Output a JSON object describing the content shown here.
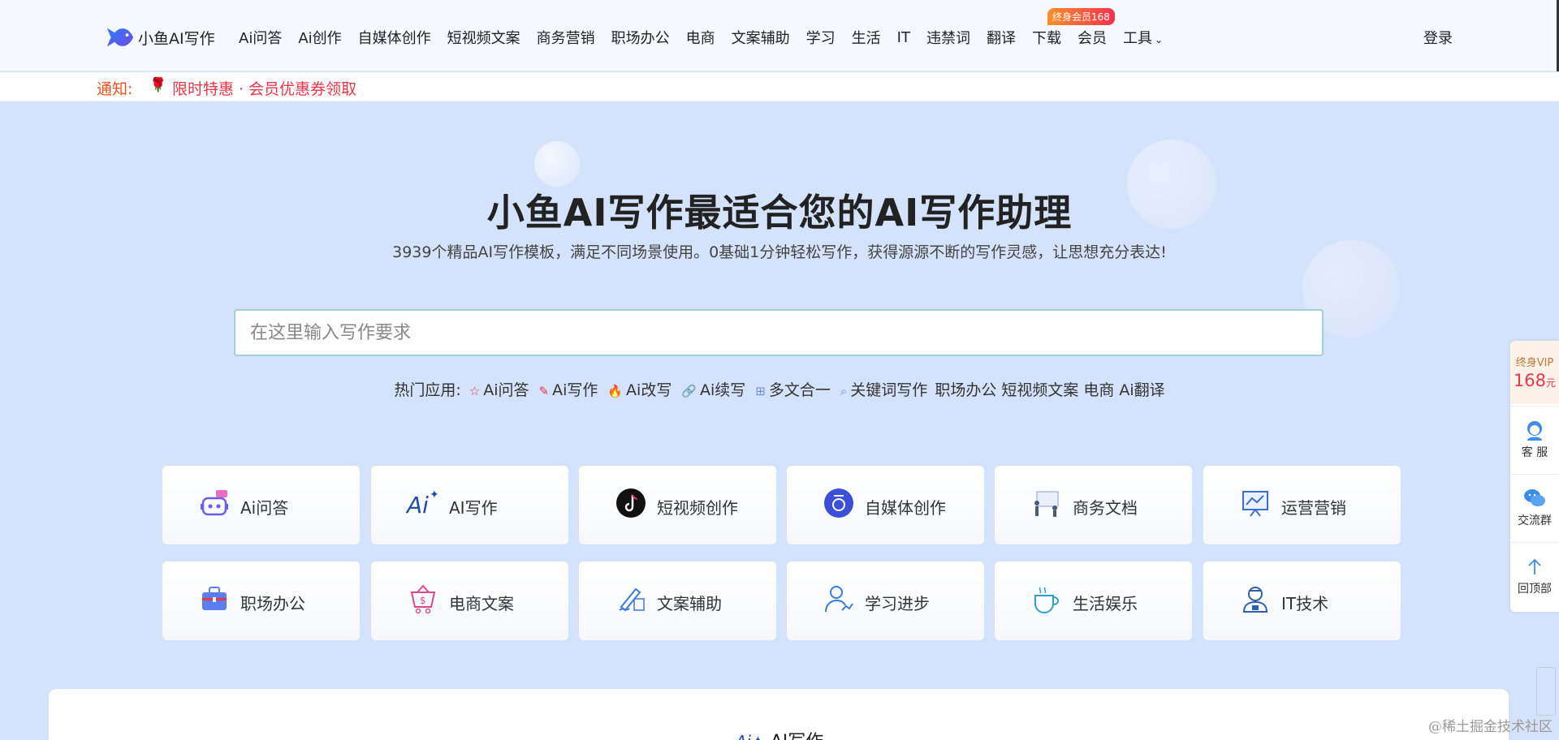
{
  "header": {
    "logo_text": "小鱼AI写作",
    "nav": [
      {
        "label": "Ai问答"
      },
      {
        "label": "Ai创作"
      },
      {
        "label": "自媒体创作"
      },
      {
        "label": "短视频文案"
      },
      {
        "label": "商务营销"
      },
      {
        "label": "职场办公"
      },
      {
        "label": "电商"
      },
      {
        "label": "文案辅助"
      },
      {
        "label": "学习"
      },
      {
        "label": "生活"
      },
      {
        "label": "IT"
      },
      {
        "label": "违禁词"
      },
      {
        "label": "翻译"
      },
      {
        "label": "下载"
      },
      {
        "label": "会员"
      },
      {
        "label": "工具"
      }
    ],
    "vip_badge": "终身会员168",
    "login": "登录"
  },
  "notice": {
    "label": "通知:",
    "text": "限时特惠 · 会员优惠券领取"
  },
  "hero": {
    "title": "小鱼AI写作最适合您的AI写作助理",
    "subtitle": "3939个精品AI写作模板，满足不同场景使用。0基础1分钟轻松写作，获得源源不断的写作灵感，让思想充分表达!",
    "search_placeholder": "在这里输入写作要求"
  },
  "hot_apps": {
    "label": "热门应用:",
    "items": [
      {
        "label": "Ai问答"
      },
      {
        "label": "Ai写作"
      },
      {
        "label": "Ai改写"
      },
      {
        "label": "Ai续写"
      },
      {
        "label": "多文合一"
      },
      {
        "label": "关键词写作"
      },
      {
        "label": "职场办公"
      },
      {
        "label": "短视频文案"
      },
      {
        "label": "电商"
      },
      {
        "label": "Ai翻译"
      }
    ]
  },
  "categories": [
    {
      "label": "Ai问答",
      "icon": "robot-icon"
    },
    {
      "label": "AI写作",
      "icon": "ai-sparkle-icon"
    },
    {
      "label": "短视频创作",
      "icon": "tiktok-icon"
    },
    {
      "label": "自媒体创作",
      "icon": "media-icon"
    },
    {
      "label": "商务文档",
      "icon": "presentation-icon"
    },
    {
      "label": "运营营销",
      "icon": "chart-board-icon"
    },
    {
      "label": "职场办公",
      "icon": "briefcase-icon"
    },
    {
      "label": "电商文案",
      "icon": "shopping-basket-icon"
    },
    {
      "label": "文案辅助",
      "icon": "pen-write-icon"
    },
    {
      "label": "学习进步",
      "icon": "user-growth-icon"
    },
    {
      "label": "生活娱乐",
      "icon": "coffee-cup-icon"
    },
    {
      "label": "IT技术",
      "icon": "engineer-icon"
    }
  ],
  "bottom": {
    "title": "AI写作"
  },
  "sidebar": {
    "vip_line1": "终身VIP",
    "vip_price": "168",
    "vip_unit": "元",
    "items": [
      {
        "label": "客 服",
        "icon": "customer-service-icon"
      },
      {
        "label": "交流群",
        "icon": "wechat-icon"
      },
      {
        "label": "回顶部",
        "icon": "arrow-up-icon"
      }
    ]
  },
  "watermark": "@稀土掘金技术社区",
  "colors": {
    "page_bg": "#d5e2fb",
    "notice_red": "#e8364b",
    "accent_teal": "#9fd3d8"
  }
}
